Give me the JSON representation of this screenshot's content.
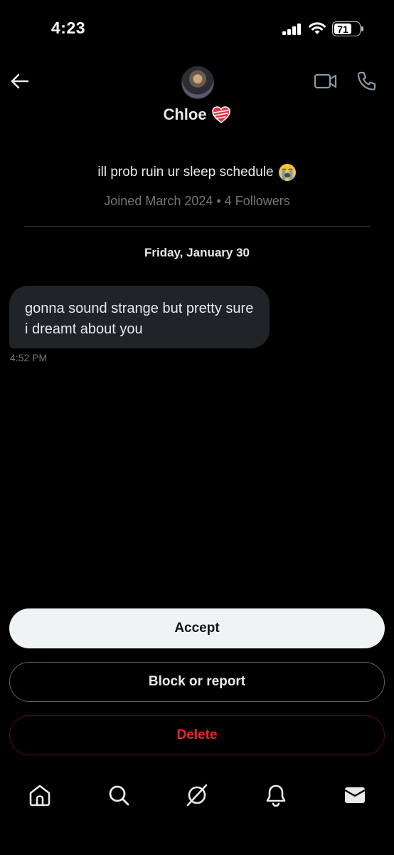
{
  "status_bar": {
    "time": "4:23",
    "battery": "71"
  },
  "header": {
    "name": "Chloe",
    "icons": [
      "back-arrow-icon",
      "video-call-icon",
      "phone-call-icon",
      "heart-emoji-icon"
    ]
  },
  "profile": {
    "bio": "ill prob ruin ur sleep schedule",
    "joined": "Joined March 2024 • 4 Followers"
  },
  "conversation": {
    "date_separator": "Friday, January 30",
    "messages": [
      {
        "text": "gonna sound strange but pretty sure i dreamt about you",
        "time": "4:52 PM"
      }
    ]
  },
  "actions": {
    "accept_label": "Accept",
    "block_label": "Block or report",
    "delete_label": "Delete"
  },
  "bottom_nav": {
    "items": [
      "home-icon",
      "search-icon",
      "grok-icon",
      "notifications-icon",
      "messages-icon"
    ],
    "active": "messages-icon"
  },
  "colors": {
    "background": "#000000",
    "bubble": "#202327",
    "muted_text": "#71767b",
    "accept_bg": "#eff3f4",
    "delete_red": "#f4212e"
  }
}
